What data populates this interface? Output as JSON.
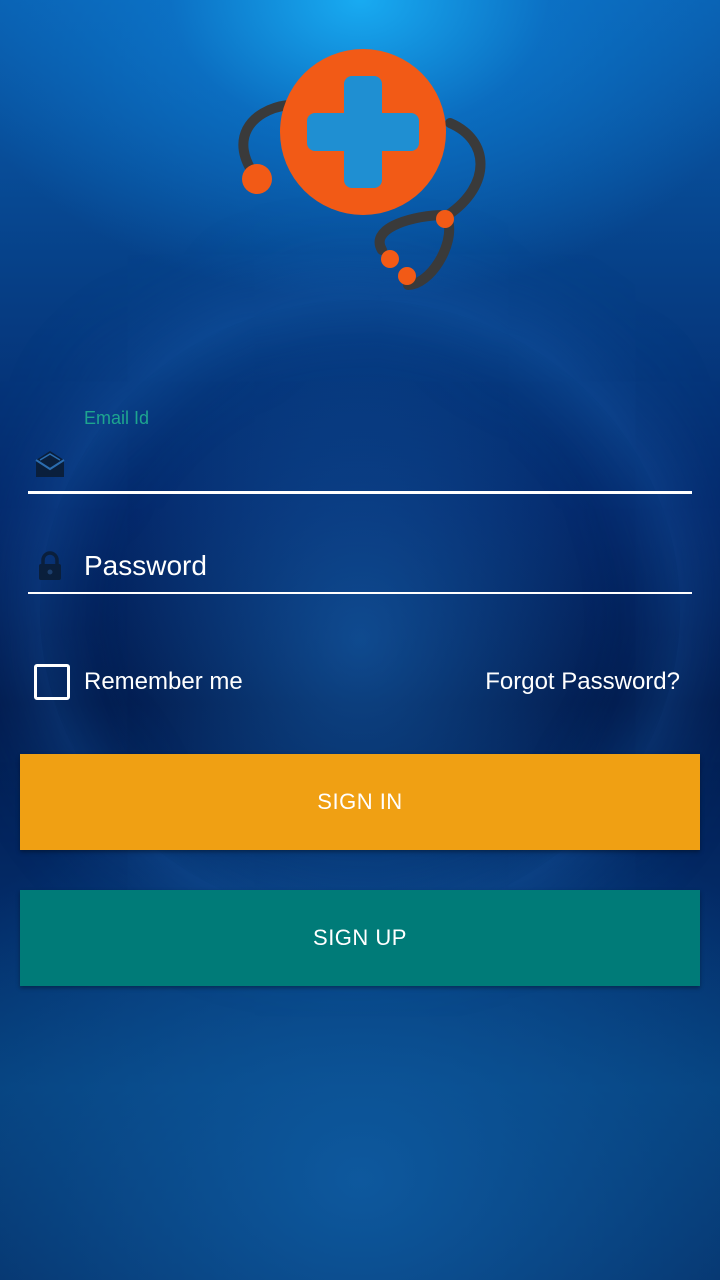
{
  "app": {
    "logo_icon": "medical-cross-stethoscope-icon"
  },
  "login": {
    "email": {
      "label": "Email Id",
      "value": "",
      "icon": "envelope-icon"
    },
    "password": {
      "placeholder": "Password",
      "value": "",
      "icon": "lock-icon"
    },
    "remember_label": "Remember me",
    "remember_checked": false,
    "forgot_label": "Forgot Password?",
    "signin_label": "SIGN IN",
    "signup_label": "SIGN UP"
  },
  "colors": {
    "accent_orange": "#f0a013",
    "accent_teal": "#007b78",
    "logo_orange": "#f25a16",
    "label_teal": "#1ea58f"
  }
}
